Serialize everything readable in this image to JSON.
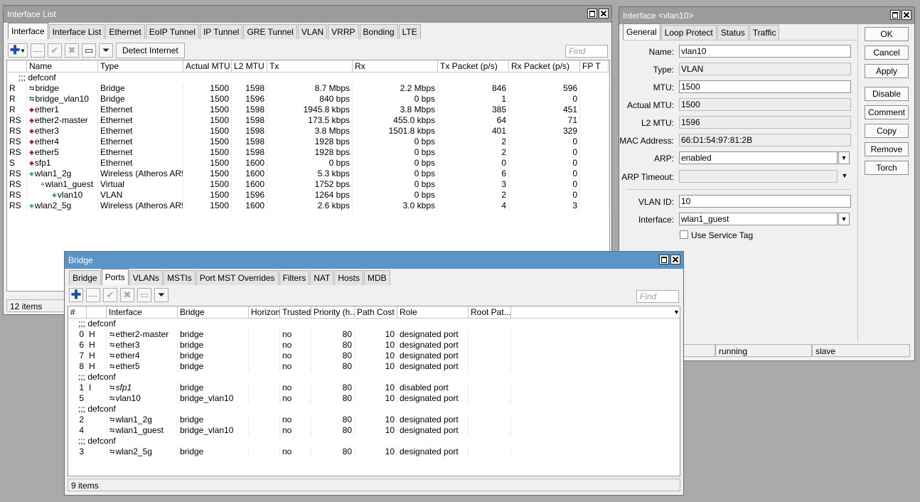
{
  "interface_list": {
    "title": "Interface List",
    "tabs": [
      "Interface",
      "Interface List",
      "Ethernet",
      "EoIP Tunnel",
      "IP Tunnel",
      "GRE Tunnel",
      "VLAN",
      "VRRP",
      "Bonding",
      "LTE"
    ],
    "detect_internet_label": "Detect Internet",
    "find_placeholder": "Find",
    "columns": [
      "",
      "Name",
      "Type",
      "Actual MTU",
      "L2 MTU",
      "Tx",
      "Rx",
      "Tx Packet (p/s)",
      "Rx Packet (p/s)",
      "FP T"
    ],
    "comment": ";;; defconf",
    "rows": [
      {
        "flags": "R",
        "name": "bridge",
        "icon": "bridge-icon",
        "type": "Bridge",
        "mtu": "1500",
        "l2mtu": "1598",
        "tx": "8.7 Mbps",
        "rx": "2.2 Mbps",
        "txp": "846",
        "rxp": "596"
      },
      {
        "flags": "R",
        "name": "bridge_vlan10",
        "icon": "bridge-icon",
        "type": "Bridge",
        "mtu": "1500",
        "l2mtu": "1596",
        "tx": "840 bps",
        "rx": "0 bps",
        "txp": "1",
        "rxp": "0"
      },
      {
        "flags": "R",
        "name": "ether1",
        "icon": "ethernet-icon",
        "type": "Ethernet",
        "mtu": "1500",
        "l2mtu": "1598",
        "tx": "1945.8 kbps",
        "rx": "3.8 Mbps",
        "txp": "385",
        "rxp": "451"
      },
      {
        "flags": "RS",
        "name": "ether2-master",
        "icon": "ethernet-icon",
        "type": "Ethernet",
        "mtu": "1500",
        "l2mtu": "1598",
        "tx": "173.5 kbps",
        "rx": "455.0 kbps",
        "txp": "64",
        "rxp": "71"
      },
      {
        "flags": "RS",
        "name": "ether3",
        "icon": "ethernet-icon",
        "type": "Ethernet",
        "mtu": "1500",
        "l2mtu": "1598",
        "tx": "3.8 Mbps",
        "rx": "1501.8 kbps",
        "txp": "401",
        "rxp": "329"
      },
      {
        "flags": "RS",
        "name": "ether4",
        "icon": "ethernet-icon",
        "type": "Ethernet",
        "mtu": "1500",
        "l2mtu": "1598",
        "tx": "1928 bps",
        "rx": "0 bps",
        "txp": "2",
        "rxp": "0"
      },
      {
        "flags": "RS",
        "name": "ether5",
        "icon": "ethernet-icon",
        "type": "Ethernet",
        "mtu": "1500",
        "l2mtu": "1598",
        "tx": "1928 bps",
        "rx": "0 bps",
        "txp": "2",
        "rxp": "0"
      },
      {
        "flags": "S",
        "name": "sfp1",
        "icon": "ethernet-icon",
        "type": "Ethernet",
        "mtu": "1500",
        "l2mtu": "1600",
        "tx": "0 bps",
        "rx": "0 bps",
        "txp": "0",
        "rxp": "0"
      },
      {
        "flags": "RS",
        "name": "wlan1_2g",
        "icon": "wireless-icon",
        "type": "Wireless (Atheros AR9...",
        "mtu": "1500",
        "l2mtu": "1600",
        "tx": "5.3 kbps",
        "rx": "0 bps",
        "txp": "6",
        "rxp": "0"
      },
      {
        "flags": "RS",
        "name": "wlan1_guest",
        "icon": "virtual-icon",
        "type": "Virtual",
        "mtu": "1500",
        "l2mtu": "1600",
        "tx": "1752 bps",
        "rx": "0 bps",
        "txp": "3",
        "rxp": "0"
      },
      {
        "flags": "RS",
        "name": "vlan10",
        "icon": "vlan-icon",
        "type": "VLAN",
        "mtu": "1500",
        "l2mtu": "1596",
        "tx": "1264 bps",
        "rx": "0 bps",
        "txp": "2",
        "rxp": "0"
      },
      {
        "flags": "RS",
        "name": "wlan2_5g",
        "icon": "wireless-icon",
        "type": "Wireless (Atheros AR9...",
        "mtu": "1500",
        "l2mtu": "1600",
        "tx": "2.6 kbps",
        "rx": "3.0 kbps",
        "txp": "4",
        "rxp": "3"
      }
    ],
    "status": "12 items"
  },
  "vlan_window": {
    "title": "Interface <vlan10>",
    "tabs": [
      "General",
      "Loop Protect",
      "Status",
      "Traffic"
    ],
    "fields": {
      "name_label": "Name:",
      "name": "vlan10",
      "type_label": "Type:",
      "type": "VLAN",
      "mtu_label": "MTU:",
      "mtu": "1500",
      "actual_mtu_label": "Actual MTU:",
      "actual_mtu": "1500",
      "l2mtu_label": "L2 MTU:",
      "l2mtu": "1596",
      "mac_label": "MAC Address:",
      "mac": "66:D1:54:97:81:2B",
      "arp_label": "ARP:",
      "arp": "enabled",
      "arp_timeout_label": "ARP Timeout:",
      "arp_timeout": "",
      "vlan_id_label": "VLAN ID:",
      "vlan_id": "10",
      "interface_label": "Interface:",
      "interface": "wlan1_guest",
      "service_tag_label": "Use Service Tag"
    },
    "buttons": [
      "OK",
      "Cancel",
      "Apply",
      "Disable",
      "Comment",
      "Copy",
      "Remove",
      "Torch"
    ],
    "status": [
      "running",
      "slave"
    ]
  },
  "bridge_window": {
    "title": "Bridge",
    "tabs": [
      "Bridge",
      "Ports",
      "VLANs",
      "MSTIs",
      "Port MST Overrides",
      "Filters",
      "NAT",
      "Hosts",
      "MDB"
    ],
    "find_placeholder": "Find",
    "columns": [
      "#",
      "",
      "Interface",
      "Bridge",
      "Horizon",
      "Trusted",
      "Priority (h...",
      "Path Cost",
      "Role",
      "Root Pat..."
    ],
    "rows": [
      {
        "comment": ";;; defconf"
      },
      {
        "num": "0",
        "flag": "H",
        "iface": "ether2-master",
        "bridge": "bridge",
        "trusted": "no",
        "priority": "80",
        "cost": "10",
        "role": "designated port"
      },
      {
        "num": "6",
        "flag": "H",
        "iface": "ether3",
        "bridge": "bridge",
        "trusted": "no",
        "priority": "80",
        "cost": "10",
        "role": "designated port"
      },
      {
        "num": "7",
        "flag": "H",
        "iface": "ether4",
        "bridge": "bridge",
        "trusted": "no",
        "priority": "80",
        "cost": "10",
        "role": "designated port"
      },
      {
        "num": "8",
        "flag": "H",
        "iface": "ether5",
        "bridge": "bridge",
        "trusted": "no",
        "priority": "80",
        "cost": "10",
        "role": "designated port"
      },
      {
        "comment": ";;; defconf"
      },
      {
        "num": "1",
        "flag": "I",
        "iface": "sfp1",
        "italic": true,
        "bridge": "bridge",
        "trusted": "no",
        "priority": "80",
        "cost": "10",
        "role": "disabled port"
      },
      {
        "num": "5",
        "flag": "",
        "iface": "vlan10",
        "bridge": "bridge_vlan10",
        "trusted": "no",
        "priority": "80",
        "cost": "10",
        "role": "designated port"
      },
      {
        "comment": ";;; defconf"
      },
      {
        "num": "2",
        "flag": "",
        "iface": "wlan1_2g",
        "bridge": "bridge",
        "trusted": "no",
        "priority": "80",
        "cost": "10",
        "role": "designated port"
      },
      {
        "num": "4",
        "flag": "",
        "iface": "wlan1_guest",
        "bridge": "bridge_vlan10",
        "trusted": "no",
        "priority": "80",
        "cost": "10",
        "role": "designated port"
      },
      {
        "comment": ";;; defconf"
      },
      {
        "num": "3",
        "flag": "",
        "iface": "wlan2_5g",
        "bridge": "bridge",
        "trusted": "no",
        "priority": "80",
        "cost": "10",
        "role": "designated port"
      }
    ],
    "status": "9 items"
  }
}
